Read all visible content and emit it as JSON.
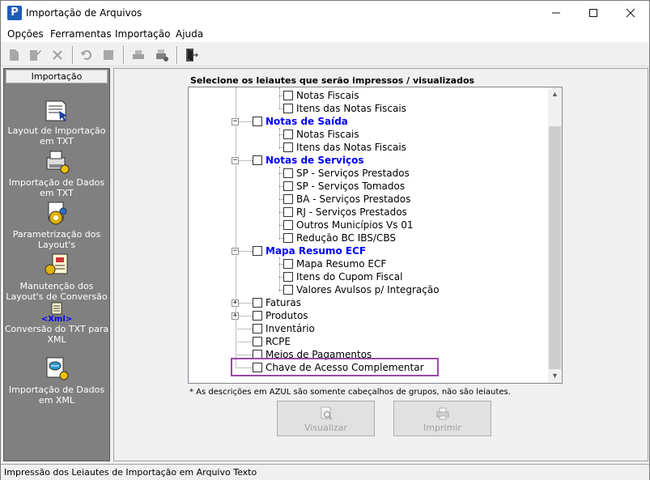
{
  "window": {
    "title": "Importação de Arquivos"
  },
  "menu": [
    "Opções",
    "Ferramentas",
    "Importação",
    "Ajuda"
  ],
  "left_panel": {
    "header": "Importação",
    "items": [
      {
        "label": "Layout de Importação em TXT",
        "icon": "layout-txt-icon"
      },
      {
        "label": "Importação de Dados em TXT",
        "icon": "import-txt-icon"
      },
      {
        "label": "Parametrização dos Layout's",
        "icon": "parameters-icon"
      },
      {
        "label": "Manutenção dos Layout's de Conversão",
        "icon": "conversion-maintenance-icon"
      },
      {
        "label": "Conversão do TXT para XML",
        "icon": "txt-to-xml-icon",
        "tag": "<Xml>"
      },
      {
        "label": "Importação de Dados em XML",
        "icon": "import-xml-icon"
      }
    ]
  },
  "main": {
    "tree_title": "Selecione os leiautes que serão impressos / visualizados",
    "tree": [
      {
        "label": "Notas Fiscais",
        "level": 1
      },
      {
        "label": "Itens das Notas Fiscais",
        "level": 1
      },
      {
        "label": "Notas de Saída",
        "level": 0,
        "group": true,
        "expanded": true
      },
      {
        "label": "Notas Fiscais",
        "level": 1
      },
      {
        "label": "Itens das Notas Fiscais",
        "level": 1
      },
      {
        "label": "Notas de Serviços",
        "level": 0,
        "group": true,
        "expanded": true
      },
      {
        "label": "SP - Serviços Prestados",
        "level": 1
      },
      {
        "label": "SP - Serviços Tomados",
        "level": 1
      },
      {
        "label": "BA - Serviços Prestados",
        "level": 1
      },
      {
        "label": "RJ - Serviços Prestados",
        "level": 1
      },
      {
        "label": "Outros Municípios Vs 01",
        "level": 1
      },
      {
        "label": "Redução BC IBS/CBS",
        "level": 1
      },
      {
        "label": "Mapa Resumo ECF",
        "level": 0,
        "group": true,
        "expanded": true
      },
      {
        "label": "Mapa Resumo ECF",
        "level": 1
      },
      {
        "label": "Itens do Cupom Fiscal",
        "level": 1
      },
      {
        "label": "Valores Avulsos p/ Integração",
        "level": 1
      },
      {
        "label": "Faturas",
        "level": 0,
        "collapsed": true
      },
      {
        "label": "Produtos",
        "level": 0,
        "collapsed": true
      },
      {
        "label": "Inventário",
        "level": 0
      },
      {
        "label": "RCPE",
        "level": 0
      },
      {
        "label": "Meios de Pagamentos",
        "level": 0
      },
      {
        "label": "Chave de Acesso Complementar",
        "level": 0
      }
    ],
    "footnote": "* As descrições em AZUL são somente cabeçalhos de grupos, não são leiautes.",
    "buttons": {
      "visualizar": "Visualizar",
      "imprimir": "Imprimir"
    }
  },
  "status": "Impressão dos Leiautes de Importação em Arquivo Texto",
  "colors": {
    "group_text": "#0000ff",
    "highlight_border": "#9b4aa6",
    "left_panel_bg": "#808080"
  }
}
